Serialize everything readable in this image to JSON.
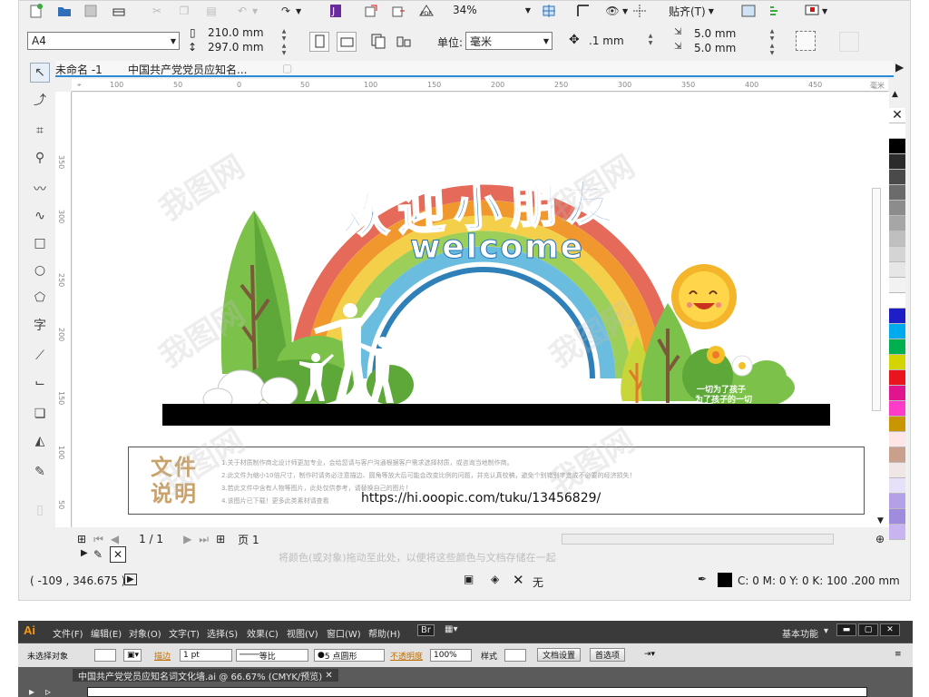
{
  "toolbar": {
    "zoom": "34%",
    "snap_label": "贴齐(T)"
  },
  "propertybar": {
    "paper_size": "A4",
    "width": "210.0 mm",
    "height": "297.0 mm",
    "units_label": "单位:",
    "units_value": "毫米",
    "nudge": ".1 mm",
    "dup_x": "5.0 mm",
    "dup_y": "5.0 mm"
  },
  "tabs": [
    "未命名 -1",
    "中国共产党党员应知名..."
  ],
  "ruler": {
    "h_ticks": [
      "100",
      "50",
      "0",
      "50",
      "100",
      "150",
      "200",
      "250",
      "300",
      "350",
      "400",
      "450",
      "500",
      "550"
    ],
    "v_ticks": [
      "350",
      "300",
      "250",
      "200",
      "150",
      "100",
      "50",
      "0"
    ],
    "unit": "毫米"
  },
  "artwork": {
    "title_cn": "欢迎小朋友",
    "title_en": "welcome",
    "slogan_1": "一切为了孩子",
    "slogan_2": "为了孩子的一切"
  },
  "note": {
    "title": "文件说明",
    "lines": [
      "1.关于材质制作商北设计师更加专业，会给您请与客户沟通根据客户需求选择材质，或咨询当地制作商。",
      "2.此文件为缩小10倍尺寸，制作时请务必注意描边、圆角等放大后可能会改变比例的问题，并充认真校稿，避免个别错别字造成不必要的经济损失！",
      "3.若此文件中含有人物等图片，此处仅供参考，请替换自己的图片！",
      "4.该图片已下载！更多此类素材请查看"
    ],
    "url": "https://hi.ooopic.com/tuku/13456829/"
  },
  "watermark": "我图网",
  "pagebar": {
    "page_count": "1 / 1",
    "page_label": "页 1"
  },
  "hint": "将颜色(或对象)拖动至此处，以便将这些颜色与文档存储在一起",
  "status": {
    "coords": "( -109 , 346.675 )",
    "fill_label": "无",
    "outline": "C: 0 M: 0 Y: 0 K: 100  .200 mm"
  },
  "palette": [
    "#ffffff",
    "#000000",
    "#2b2b2b",
    "#4a4a4a",
    "#6b6b6b",
    "#8c8c8c",
    "#a6a6a6",
    "#bfbfbf",
    "#d4d4d4",
    "#e6e6e6",
    "#f2f2f2",
    "#ffffff",
    "#1e1ec8",
    "#00aaee",
    "#00b050",
    "#d4d400",
    "#e8141e",
    "#e0148c",
    "#ff3cc8",
    "#c89600",
    "#ffe6e6",
    "#c8a08c",
    "#f0e6e6",
    "#e6e0f8",
    "#b4a0e6",
    "#a08cdc",
    "#c8b4f0"
  ],
  "illustrator": {
    "logo": "Ai",
    "menus": [
      "文件(F)",
      "编辑(E)",
      "对象(O)",
      "文字(T)",
      "选择(S)",
      "效果(C)",
      "视图(V)",
      "窗口(W)",
      "帮助(H)"
    ],
    "bridge": "Br",
    "workspace": "基本功能",
    "no_selection": "未选择对象",
    "stroke_label": "描边",
    "stroke_value": "1 pt",
    "stroke_style": "等比",
    "brush": "5 点圆形",
    "opacity_label": "不透明度",
    "opacity_value": "100%",
    "style_label": "样式",
    "doc_setup": "文档设置",
    "prefs": "首选项",
    "doc_tab": "中国共产党党员应知名词文化墙.ai @ 66.67% (CMYK/预览)"
  }
}
